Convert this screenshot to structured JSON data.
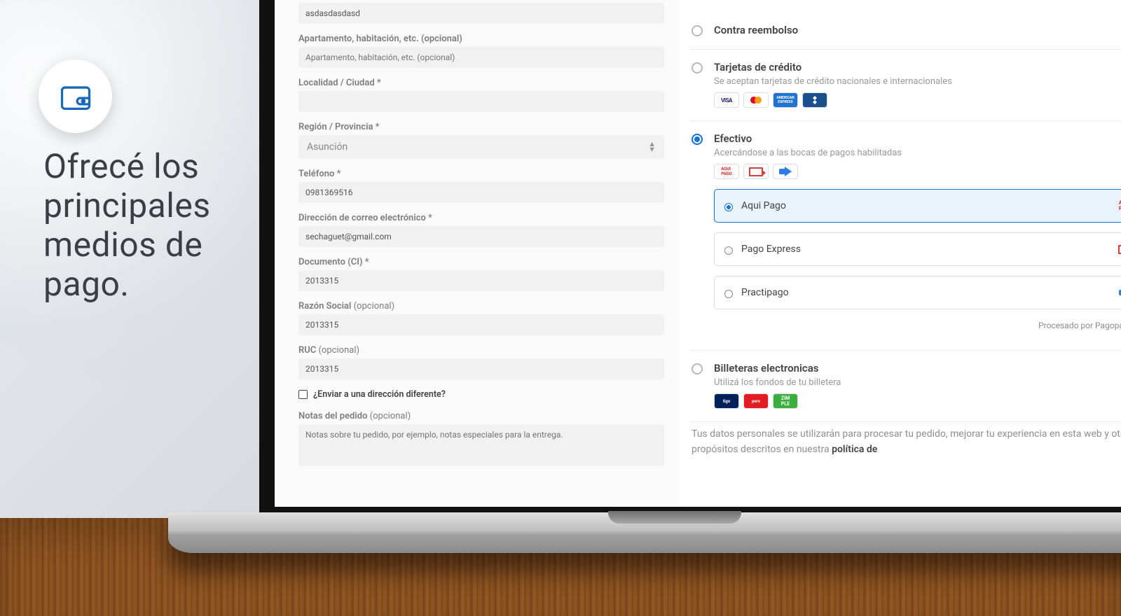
{
  "hero": {
    "title": "Ofrecé los principales medios de pago."
  },
  "form": {
    "address": {
      "value": "asdasdasdasd"
    },
    "apt": {
      "label": "Apartamento, habitación, etc. (opcional)",
      "placeholder": "Apartamento, habitación, etc. (opcional)",
      "value": ""
    },
    "city": {
      "label": "Localidad / Ciudad *",
      "value": ""
    },
    "region": {
      "label": "Región / Provincia *",
      "value": "Asunción"
    },
    "phone": {
      "label": "Teléfono *",
      "value": "0981369516"
    },
    "email": {
      "label": "Dirección de correo electrónico *",
      "value": "sechaguet@gmail.com"
    },
    "doc": {
      "label": "Documento (CI) *",
      "value": "2013315"
    },
    "razon": {
      "label": "Razón Social",
      "opt": "(opcional)",
      "value": "2013315"
    },
    "ruc": {
      "label": "RUC",
      "opt": "(opcional)",
      "value": "2013315"
    },
    "ship_diff": {
      "label": "¿Enviar a una dirección diferente?"
    },
    "notes": {
      "label": "Notas del pedido",
      "opt": "(opcional)",
      "placeholder": "Notas sobre tu pedido, por ejemplo, notas especiales para la entrega."
    }
  },
  "payment": {
    "options": [
      {
        "id": "cod",
        "title": "Contra reembolso",
        "selected": false
      },
      {
        "id": "cards",
        "title": "Tarjetas de crédito",
        "desc": "Se aceptan tarjetas de crédito nacionales e internacionales",
        "selected": false
      },
      {
        "id": "cash",
        "title": "Efectivo",
        "desc": "Acercándose a las bocas de pagos habilitadas",
        "selected": true,
        "sub": [
          {
            "id": "aqui",
            "label": "Aqui Pago",
            "selected": true
          },
          {
            "id": "pagoex",
            "label": "Pago Express",
            "selected": false
          },
          {
            "id": "practi",
            "label": "Practipago",
            "selected": false
          }
        ]
      },
      {
        "id": "wallet",
        "title": "Billeteras electronicas",
        "desc": "Utilizá los fondos de tu billetera",
        "selected": false
      }
    ],
    "processed_label": "Procesado por Pagopar"
  },
  "legal": {
    "text": "Tus datos personales se utilizarán para procesar tu pedido, mejorar tu experiencia en esta web y otros propósitos descritos en nuestra ",
    "link": "política de"
  }
}
